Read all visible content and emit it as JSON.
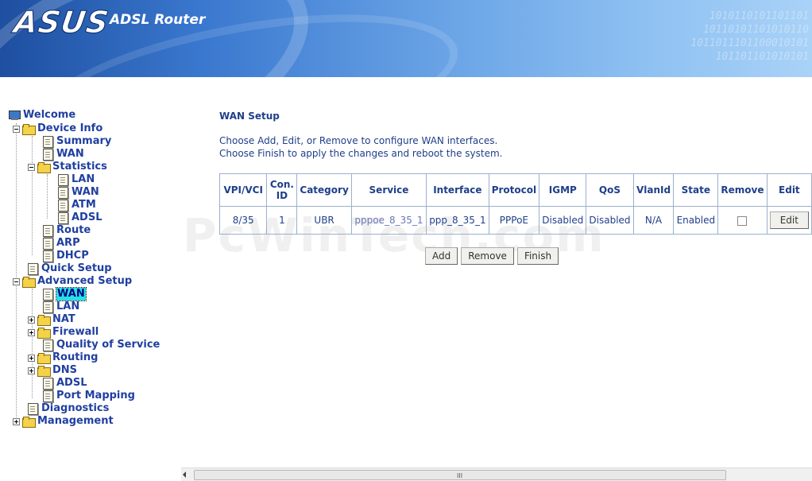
{
  "header": {
    "logo": "ASUS",
    "product": "ADSL Router",
    "binary_lines": [
      "1010110101101101",
      "10110101101010110",
      "1011011101100010101",
      "101101101010101"
    ]
  },
  "nav": {
    "items": [
      {
        "label": "Welcome"
      },
      {
        "label": "Device Info"
      },
      {
        "label": "Summary"
      },
      {
        "label": "WAN"
      },
      {
        "label": "Statistics"
      },
      {
        "label": "LAN"
      },
      {
        "label": "WAN"
      },
      {
        "label": "ATM"
      },
      {
        "label": "ADSL"
      },
      {
        "label": "Route"
      },
      {
        "label": "ARP"
      },
      {
        "label": "DHCP"
      },
      {
        "label": "Quick Setup"
      },
      {
        "label": "Advanced Setup"
      },
      {
        "label": "WAN",
        "selected": true
      },
      {
        "label": "LAN"
      },
      {
        "label": "NAT"
      },
      {
        "label": "Firewall"
      },
      {
        "label": "Quality of Service"
      },
      {
        "label": "Routing"
      },
      {
        "label": "DNS"
      },
      {
        "label": "ADSL"
      },
      {
        "label": "Port Mapping"
      },
      {
        "label": "Diagnostics"
      },
      {
        "label": "Management"
      }
    ]
  },
  "main": {
    "title": "WAN Setup",
    "desc1": "Choose Add, Edit, or Remove to configure WAN interfaces.",
    "desc2": "Choose Finish to apply the changes and reboot the system."
  },
  "table": {
    "headers": [
      "VPI/VCI",
      "Con. ID",
      "Category",
      "Service",
      "Interface",
      "Protocol",
      "IGMP",
      "QoS",
      "VlanId",
      "State",
      "Remove",
      "Edit"
    ],
    "row": {
      "vpi_vci": "8/35",
      "con_id": "1",
      "category": "UBR",
      "service": "pppoe_8_35_1",
      "interface": "ppp_8_35_1",
      "protocol": "PPPoE",
      "igmp": "Disabled",
      "qos": "Disabled",
      "vlanid": "N/A",
      "state": "Enabled",
      "remove_checked": false,
      "edit_label": "Edit"
    }
  },
  "buttons": {
    "add": "Add",
    "remove": "Remove",
    "finish": "Finish"
  },
  "watermark": "PcWinTech.com",
  "scrollbar": {
    "grip": "III"
  }
}
